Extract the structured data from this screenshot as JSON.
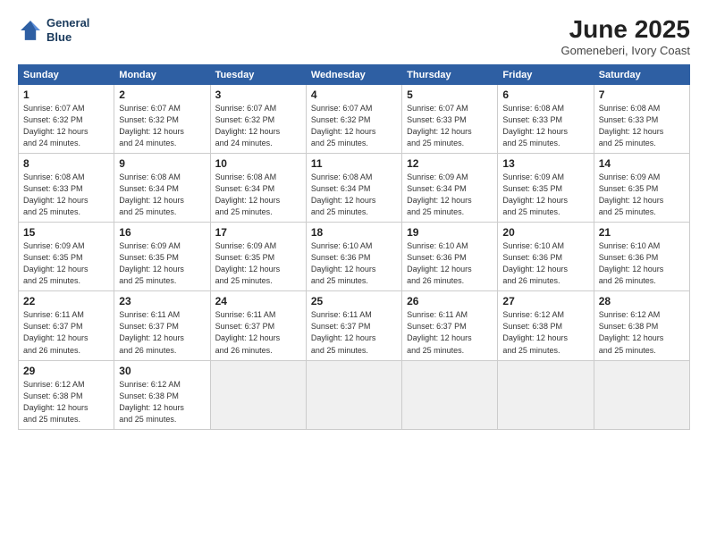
{
  "logo": {
    "line1": "General",
    "line2": "Blue"
  },
  "title": "June 2025",
  "subtitle": "Gomeneberi, Ivory Coast",
  "days_header": [
    "Sunday",
    "Monday",
    "Tuesday",
    "Wednesday",
    "Thursday",
    "Friday",
    "Saturday"
  ],
  "weeks": [
    [
      {
        "day": 1,
        "info": "Sunrise: 6:07 AM\nSunset: 6:32 PM\nDaylight: 12 hours\nand 24 minutes."
      },
      {
        "day": 2,
        "info": "Sunrise: 6:07 AM\nSunset: 6:32 PM\nDaylight: 12 hours\nand 24 minutes."
      },
      {
        "day": 3,
        "info": "Sunrise: 6:07 AM\nSunset: 6:32 PM\nDaylight: 12 hours\nand 24 minutes."
      },
      {
        "day": 4,
        "info": "Sunrise: 6:07 AM\nSunset: 6:32 PM\nDaylight: 12 hours\nand 25 minutes."
      },
      {
        "day": 5,
        "info": "Sunrise: 6:07 AM\nSunset: 6:33 PM\nDaylight: 12 hours\nand 25 minutes."
      },
      {
        "day": 6,
        "info": "Sunrise: 6:08 AM\nSunset: 6:33 PM\nDaylight: 12 hours\nand 25 minutes."
      },
      {
        "day": 7,
        "info": "Sunrise: 6:08 AM\nSunset: 6:33 PM\nDaylight: 12 hours\nand 25 minutes."
      }
    ],
    [
      {
        "day": 8,
        "info": "Sunrise: 6:08 AM\nSunset: 6:33 PM\nDaylight: 12 hours\nand 25 minutes."
      },
      {
        "day": 9,
        "info": "Sunrise: 6:08 AM\nSunset: 6:34 PM\nDaylight: 12 hours\nand 25 minutes."
      },
      {
        "day": 10,
        "info": "Sunrise: 6:08 AM\nSunset: 6:34 PM\nDaylight: 12 hours\nand 25 minutes."
      },
      {
        "day": 11,
        "info": "Sunrise: 6:08 AM\nSunset: 6:34 PM\nDaylight: 12 hours\nand 25 minutes."
      },
      {
        "day": 12,
        "info": "Sunrise: 6:09 AM\nSunset: 6:34 PM\nDaylight: 12 hours\nand 25 minutes."
      },
      {
        "day": 13,
        "info": "Sunrise: 6:09 AM\nSunset: 6:35 PM\nDaylight: 12 hours\nand 25 minutes."
      },
      {
        "day": 14,
        "info": "Sunrise: 6:09 AM\nSunset: 6:35 PM\nDaylight: 12 hours\nand 25 minutes."
      }
    ],
    [
      {
        "day": 15,
        "info": "Sunrise: 6:09 AM\nSunset: 6:35 PM\nDaylight: 12 hours\nand 25 minutes."
      },
      {
        "day": 16,
        "info": "Sunrise: 6:09 AM\nSunset: 6:35 PM\nDaylight: 12 hours\nand 25 minutes."
      },
      {
        "day": 17,
        "info": "Sunrise: 6:09 AM\nSunset: 6:35 PM\nDaylight: 12 hours\nand 25 minutes."
      },
      {
        "day": 18,
        "info": "Sunrise: 6:10 AM\nSunset: 6:36 PM\nDaylight: 12 hours\nand 25 minutes."
      },
      {
        "day": 19,
        "info": "Sunrise: 6:10 AM\nSunset: 6:36 PM\nDaylight: 12 hours\nand 26 minutes."
      },
      {
        "day": 20,
        "info": "Sunrise: 6:10 AM\nSunset: 6:36 PM\nDaylight: 12 hours\nand 26 minutes."
      },
      {
        "day": 21,
        "info": "Sunrise: 6:10 AM\nSunset: 6:36 PM\nDaylight: 12 hours\nand 26 minutes."
      }
    ],
    [
      {
        "day": 22,
        "info": "Sunrise: 6:11 AM\nSunset: 6:37 PM\nDaylight: 12 hours\nand 26 minutes."
      },
      {
        "day": 23,
        "info": "Sunrise: 6:11 AM\nSunset: 6:37 PM\nDaylight: 12 hours\nand 26 minutes."
      },
      {
        "day": 24,
        "info": "Sunrise: 6:11 AM\nSunset: 6:37 PM\nDaylight: 12 hours\nand 26 minutes."
      },
      {
        "day": 25,
        "info": "Sunrise: 6:11 AM\nSunset: 6:37 PM\nDaylight: 12 hours\nand 25 minutes."
      },
      {
        "day": 26,
        "info": "Sunrise: 6:11 AM\nSunset: 6:37 PM\nDaylight: 12 hours\nand 25 minutes."
      },
      {
        "day": 27,
        "info": "Sunrise: 6:12 AM\nSunset: 6:38 PM\nDaylight: 12 hours\nand 25 minutes."
      },
      {
        "day": 28,
        "info": "Sunrise: 6:12 AM\nSunset: 6:38 PM\nDaylight: 12 hours\nand 25 minutes."
      }
    ],
    [
      {
        "day": 29,
        "info": "Sunrise: 6:12 AM\nSunset: 6:38 PM\nDaylight: 12 hours\nand 25 minutes."
      },
      {
        "day": 30,
        "info": "Sunrise: 6:12 AM\nSunset: 6:38 PM\nDaylight: 12 hours\nand 25 minutes."
      },
      null,
      null,
      null,
      null,
      null
    ]
  ]
}
